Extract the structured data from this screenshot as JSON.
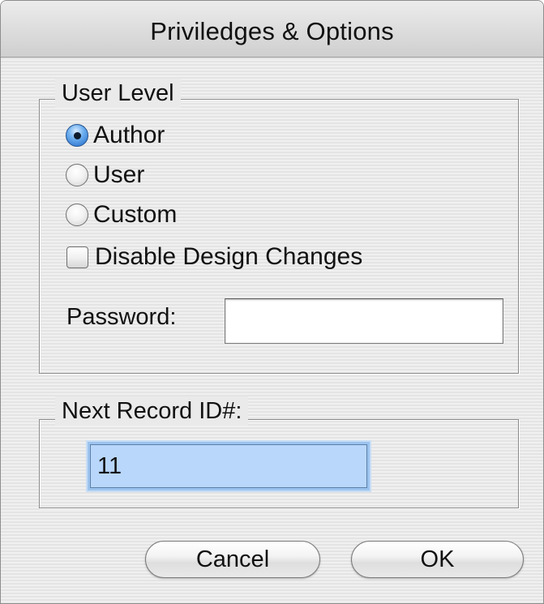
{
  "window": {
    "title": "Priviledges & Options"
  },
  "user_level": {
    "label": "User Level",
    "options": [
      {
        "label": "Author",
        "checked": true
      },
      {
        "label": "User",
        "checked": false
      },
      {
        "label": "Custom",
        "checked": false
      }
    ],
    "disable_design_changes": {
      "label": "Disable Design Changes",
      "checked": false
    },
    "password": {
      "label": "Password:",
      "value": ""
    }
  },
  "next_record": {
    "label": "Next Record ID#:",
    "value": "11"
  },
  "buttons": {
    "cancel": "Cancel",
    "ok": "OK"
  },
  "colors": {
    "selected_radio": "#1d67c9",
    "focused_field": "#b9d7fb"
  }
}
